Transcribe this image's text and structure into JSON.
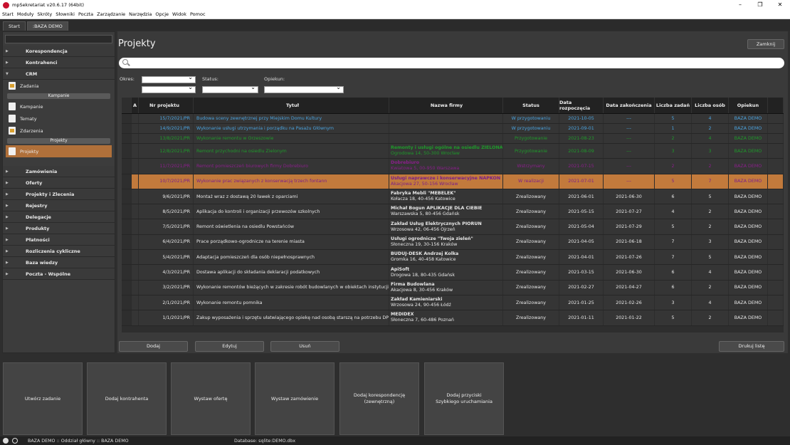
{
  "window": {
    "title": "mpSekretariat v20.6.17 (64bit)"
  },
  "menu": [
    "Start",
    "Moduły",
    "Skróty",
    "Słowniki",
    "Poczta",
    "Zarządzanie",
    "Narzędzia",
    "Opcje",
    "Widok",
    "Pomoc"
  ],
  "tabs": [
    "Start",
    ":BAZA DEMO"
  ],
  "sidebar": {
    "sections": [
      "Korespondencja",
      "Kontrahenci",
      "CRM"
    ],
    "crm_items": [
      "Zadania"
    ],
    "kampanie_header": "Kampanie",
    "kampanie_items": [
      "Kampanie",
      "Tematy",
      "Zdarzenia"
    ],
    "projekty_header": "Projekty",
    "projekty_items": [
      "Projekty"
    ],
    "lower_sections": [
      "Zamówienia",
      "Oferty",
      "Projekty i Zlecenia",
      "Rejestry",
      "Delegacje",
      "Produkty",
      "Płatności",
      "Rozliczenia cykliczne",
      "Baza wiedzy",
      "Poczta - Wspólne"
    ]
  },
  "page": {
    "title": "Projekty",
    "close_label": "Zamknij"
  },
  "search": {
    "placeholder": ""
  },
  "filters": {
    "okres_label": "Okres:",
    "status_label": "Status:",
    "opiekun_label": "Opiekun:"
  },
  "table": {
    "headers": {
      "a": "A",
      "nr": "Nr projektu",
      "tytul": "Tytuł",
      "firma": "Nazwa firmy",
      "status": "Status",
      "data_rozp": "Data rozpoczęcia",
      "data_zak": "Data zakończenia",
      "liczba_zadan": "Liczba zadań",
      "liczba_osob": "Liczba osób",
      "opiekun": "Opiekun"
    },
    "rows": [
      {
        "nr": "15/7/2021/PR",
        "tytul": "Budowa sceny zewnętrznej przy Miejskim Domu Kultury",
        "firma": "",
        "adres": "",
        "status": "W przygotowaniu",
        "dr": "2021-10-05",
        "dz": "---",
        "lz": "5",
        "lo": "4",
        "op": "BAZA DEMO",
        "cls": "blue",
        "short": true
      },
      {
        "nr": "14/9/2021/PR",
        "tytul": "Wykonanie usługi utrzymania i porządku na Pasażu Głównym",
        "firma": "",
        "adres": "",
        "status": "W przygotowaniu",
        "dr": "2021-09-01",
        "dz": "---",
        "lz": "1",
        "lo": "2",
        "op": "BAZA DEMO",
        "cls": "blue",
        "short": true
      },
      {
        "nr": "13/8/2021/PR",
        "tytul": "Wykonanie remontu w Orzeszowie",
        "firma": "",
        "adres": "",
        "status": "Przygotowanie",
        "dr": "2021-08-23",
        "dz": "---",
        "lz": "2",
        "lo": "4",
        "op": "BAZA DEMO",
        "cls": "green",
        "short": true
      },
      {
        "nr": "12/8/2021/PR",
        "tytul": "Remont przychodni na osiedlu Zielonym",
        "firma": "Remonty i usługi ogólne na osiedlu ZIELONA DZIAŁKA",
        "adres": "Ogrodowa 14, 50-300 Wrocław",
        "status": "Przygotowanie",
        "dr": "2021-08-09",
        "dz": "---",
        "lz": "3",
        "lo": "3",
        "op": "BAZA DEMO",
        "cls": "green",
        "short": false
      },
      {
        "nr": "11/7/2021/PR",
        "tytul": "Remont pomieszczeń biurowych firmy Dobrebiuro",
        "firma": "Dobrebiuro",
        "adres": "Kwiatowa 5, 00-950 Warszawa",
        "status": "Wstrzymany",
        "dr": "2021-07-15",
        "dz": "---",
        "lz": "2",
        "lo": "2",
        "op": "BAZA DEMO",
        "cls": "purple",
        "short": false
      },
      {
        "nr": "10/7/2021/PR",
        "tytul": "Wykonanie prac związanych z konserwacją trzech fontann",
        "firma": "Usługi naprawcze i konserwacyjne NAPKON",
        "adres": "Akacjowa 27, 50-156 Wrocław",
        "status": "W realizacji",
        "dr": "2021-07-01",
        "dz": "---",
        "lz": "5",
        "lo": "7",
        "op": "BAZA DEMO",
        "cls": "hl",
        "short": false
      },
      {
        "nr": "9/6/2021/PR",
        "tytul": "Montaż wraz z dostawą 20 ławek z oparciami",
        "firma": "Fabryka Mebli \"MEBELEK\"",
        "adres": "Kołacza 18, 40-456 Katowice",
        "status": "Zrealizowany",
        "dr": "2021-06-01",
        "dz": "2021-06-30",
        "lz": "6",
        "lo": "5",
        "op": "BAZA DEMO",
        "cls": "white",
        "short": false
      },
      {
        "nr": "8/5/2021/PR",
        "tytul": "Aplikacja do kontroli i organizacji przewozów szkolnych",
        "firma": "Michał Bogun APLIKACJE DLA CIEBIE",
        "adres": "Warszawska 5, 80-456 Gdańsk",
        "status": "Zrealizowany",
        "dr": "2021-05-15",
        "dz": "2021-07-27",
        "lz": "4",
        "lo": "2",
        "op": "BAZA DEMO",
        "cls": "white",
        "short": false
      },
      {
        "nr": "7/5/2021/PR",
        "tytul": "Remont oświetlenia na osiedlu Powstańców",
        "firma": "Zakład Usług Elektrycznych PIORUN",
        "adres": "Wrzosowa 42, 06-456 Ojrzeń",
        "status": "Zrealizowany",
        "dr": "2021-05-04",
        "dz": "2021-07-29",
        "lz": "5",
        "lo": "2",
        "op": "BAZA DEMO",
        "cls": "white",
        "short": false
      },
      {
        "nr": "6/4/2021/PR",
        "tytul": "Prace porządkowo-ogrodnicze na terenie miasta",
        "firma": "Usługi ogrodnicze \"Twoja zieleń\"",
        "adres": "Słoneczna 19, 30-156 Kraków",
        "status": "Zrealizowany",
        "dr": "2021-04-05",
        "dz": "2021-06-18",
        "lz": "7",
        "lo": "3",
        "op": "BAZA DEMO",
        "cls": "white",
        "short": false
      },
      {
        "nr": "5/4/2021/PR",
        "tytul": "Adaptacja pomieszczeń dla osób niepełnosprawnych",
        "firma": "BUDUJ-DESK Andrzej Kolka",
        "adres": "Gromka 16, 40-458 Katowice",
        "status": "Zrealizowany",
        "dr": "2021-04-01",
        "dz": "2021-07-26",
        "lz": "7",
        "lo": "5",
        "op": "BAZA DEMO",
        "cls": "white",
        "short": false
      },
      {
        "nr": "4/3/2021/PR",
        "tytul": "Dostawa aplikacji do składania deklaracji podatkowych",
        "firma": "ApiSoft",
        "adres": "Drogowa 18, 80-435 Gdańsk",
        "status": "Zrealizowany",
        "dr": "2021-03-15",
        "dz": "2021-06-30",
        "lz": "6",
        "lo": "4",
        "op": "BAZA DEMO",
        "cls": "white",
        "short": false
      },
      {
        "nr": "3/2/2021/PR",
        "tytul": "Wykonanie remontów bieżących w zakresie robót budowlanych w obiektach instytucji",
        "firma": "Firma Budowlana",
        "adres": "Akacjowa 8, 30-456 Kraków",
        "status": "Zrealizowany",
        "dr": "2021-02-27",
        "dz": "2021-04-27",
        "lz": "6",
        "lo": "2",
        "op": "BAZA DEMO",
        "cls": "white",
        "short": false
      },
      {
        "nr": "2/1/2021/PR",
        "tytul": "Wykonanie remontu pomnika",
        "firma": "Zakład Kamieniarski",
        "adres": "Wrzosowa 24, 90-456 Łódź",
        "status": "Zrealizowany",
        "dr": "2021-01-25",
        "dz": "2021-02-26",
        "lz": "3",
        "lo": "4",
        "op": "BAZA DEMO",
        "cls": "white",
        "short": false
      },
      {
        "nr": "1/1/2021/PR",
        "tytul": "Zakup wyposażenia i sprzętu ułatwiającego opiekę nad osobą starszą na potrzebu DPS",
        "firma": "MEDIDEX",
        "adres": "Słoneczna 7, 60-486 Poznań",
        "status": "Zrealizowany",
        "dr": "2021-01-11",
        "dz": "2021-01-22",
        "lz": "5",
        "lo": "2",
        "op": "BAZA DEMO",
        "cls": "white",
        "short": false
      }
    ]
  },
  "grid_buttons": {
    "dodaj": "Dodaj",
    "edytuj": "Edytuj",
    "usun": "Usuń",
    "drukuj": "Drukuj listę"
  },
  "shortcuts": [
    "Utwórz zadanie",
    "Dodaj kontrahenta",
    "Wystaw ofertę",
    "Wystaw zamówienie",
    "Dodaj korespondencję\n(zewnętrzną)",
    "Dodaj przyciski\nSzybkiego uruchamiania"
  ],
  "statusbar": {
    "left": "BAZA DEMO :: Oddział główny :: BAZA DEMO",
    "db": "Database: sqlite:DEMO.dbx"
  }
}
